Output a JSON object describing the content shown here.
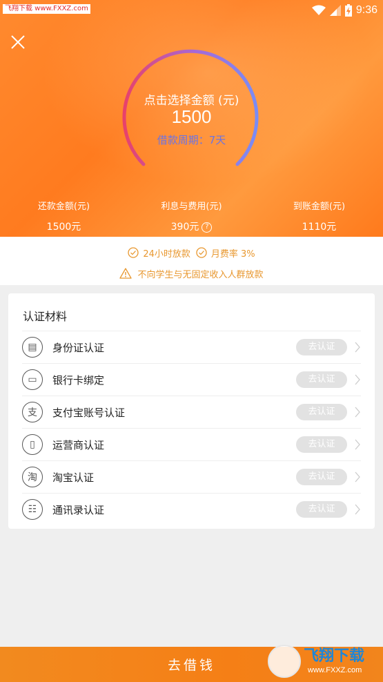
{
  "status_bar": {
    "watermark": "飞翔下载 www.FXXZ.com",
    "time": "9:36"
  },
  "gauge": {
    "title": "点击选择金额 (元)",
    "amount": "1500",
    "period": "借款周期：7天",
    "colors": {
      "start": "#e8416b",
      "end": "#7a8cf5"
    }
  },
  "summary": [
    {
      "label": "还款金额(元)",
      "value": "1500元"
    },
    {
      "label": "利息与费用(元)",
      "value": "390元",
      "help": "?"
    },
    {
      "label": "到账金额(元)",
      "value": "1110元"
    }
  ],
  "notices": {
    "fast_loan": "24小时放款",
    "monthly_rate": "月费率 3%",
    "warning": "不向学生与无固定收入人群放款"
  },
  "certification": {
    "title": "认证材料",
    "items": [
      {
        "label": "身份证认证",
        "icon": "id-card-icon",
        "glyph": "▤",
        "button": "去认证"
      },
      {
        "label": "银行卡绑定",
        "icon": "bank-card-icon",
        "glyph": "▭",
        "button": "去认证"
      },
      {
        "label": "支付宝账号认证",
        "icon": "alipay-icon",
        "glyph": "支",
        "button": "去认证"
      },
      {
        "label": "运营商认证",
        "icon": "phone-icon",
        "glyph": "▯",
        "button": "去认证"
      },
      {
        "label": "淘宝认证",
        "icon": "taobao-icon",
        "glyph": "淘",
        "button": "去认证"
      },
      {
        "label": "通讯录认证",
        "icon": "contacts-icon",
        "glyph": "☷",
        "button": "去认证"
      }
    ]
  },
  "bottom": {
    "cta": "去借钱"
  },
  "watermark_logo": {
    "text": "飞翔下载",
    "url": "www.FXXZ.com"
  },
  "colors": {
    "header": "#ff8229",
    "accent_orange": "#e8972e",
    "period_text": "#6a73e6",
    "button_disabled": "#e2e2e2"
  }
}
